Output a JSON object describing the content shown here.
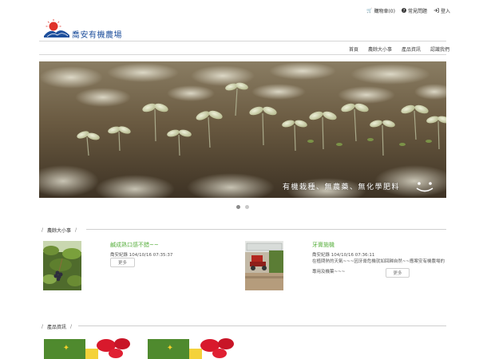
{
  "top_links": {
    "cart": "購物車(0)",
    "faq": "常見問題",
    "login": "登入"
  },
  "logo": {
    "name": "喬安有機農場"
  },
  "nav": [
    "首頁",
    "農餘大小事",
    "產品資訊",
    "認識我們"
  ],
  "banner": {
    "slogan": "有機栽種、無農藥、無化學肥料"
  },
  "carousel": {
    "count": 2,
    "active": 0
  },
  "news_section": {
    "title": "農餘大小事",
    "items": [
      {
        "title": "鹹成熟口感不錯~~",
        "meta": "喬安紀錄 104/10/16 07:35:37",
        "body": "",
        "more": "更多"
      },
      {
        "title": "牙膏施機",
        "meta": "喬安紀錄 104/10/16 07:36:11",
        "body": "在植問熱的天氣~~~因牙膏危機就如回歸自然~~應案安有機農場的專用及機葉~~~",
        "more": "更多"
      }
    ]
  },
  "products_section": {
    "title": "產品資訊"
  },
  "colors": {
    "accent_green": "#5ab040",
    "logo_blue": "#1e4f9c"
  }
}
